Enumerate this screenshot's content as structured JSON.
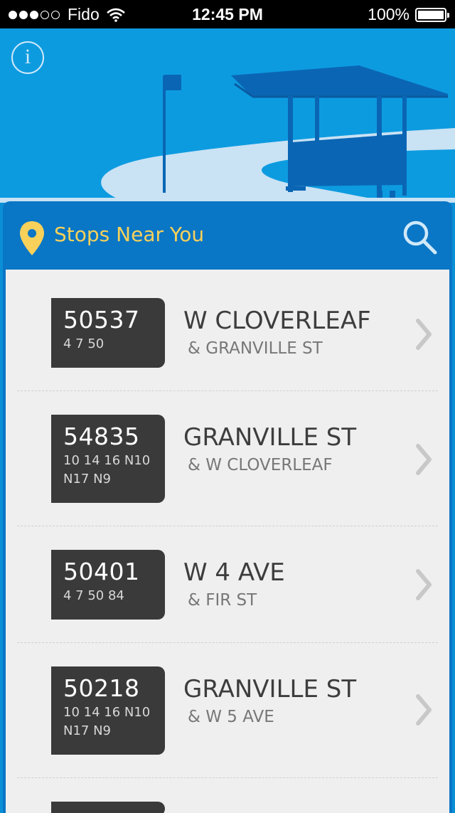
{
  "status_bar": {
    "carrier": "Fido",
    "time": "12:45 PM",
    "battery": "100%"
  },
  "header": {
    "title": "Stops Near You"
  },
  "colors": {
    "sky": "#0d9be0",
    "card_blue": "#0a76c6",
    "title_yellow": "#f7d15a",
    "badge_dark": "#3a3a3a"
  },
  "stops": [
    {
      "code": "50537",
      "routes": "4 7 50",
      "street": "W CLOVERLEAF",
      "cross": "& GRANVILLE ST"
    },
    {
      "code": "54835",
      "routes": "10 14 16 N10 N17 N9",
      "street": "GRANVILLE ST",
      "cross": "& W CLOVERLEAF"
    },
    {
      "code": "50401",
      "routes": "4 7 50 84",
      "street": "W 4 AVE",
      "cross": "& FIR ST"
    },
    {
      "code": "50218",
      "routes": "10 14 16 N10 N17 N9",
      "street": "GRANVILLE ST",
      "cross": "& W 5 AVE"
    }
  ]
}
